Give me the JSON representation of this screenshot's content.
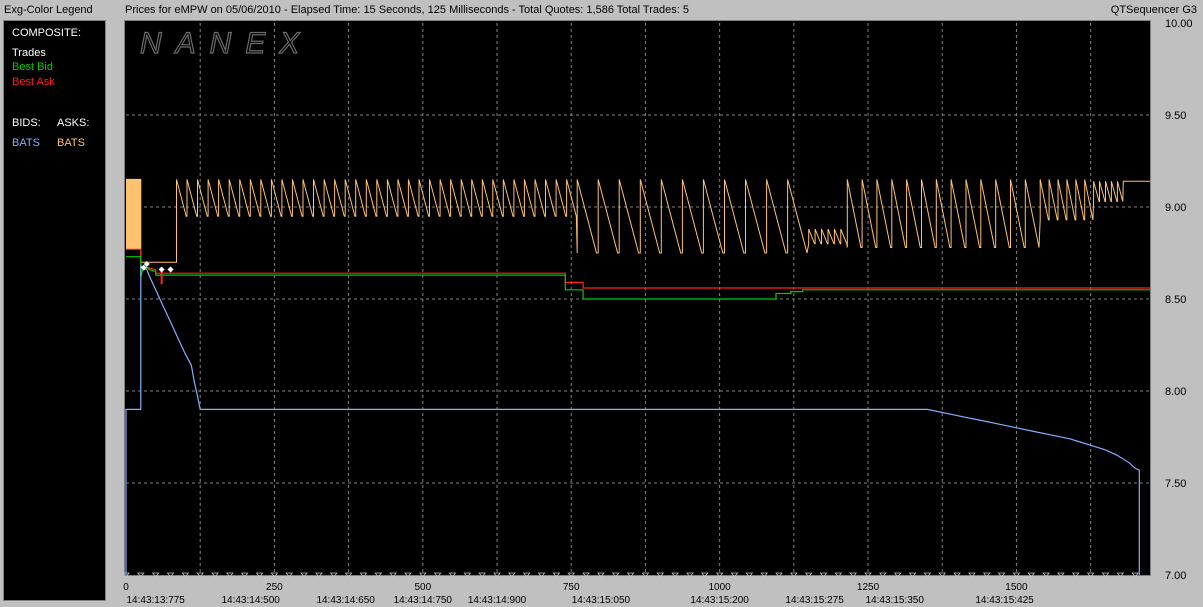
{
  "header": {
    "legend_title": "Exg-Color Legend",
    "chart_title": "Prices for  eMPW  on  05/06/2010  -  Elapsed Time: 15 Seconds, 125 Milliseconds  -  Total Quotes: 1,586  Total Trades: 5",
    "app_name": "QTSequencer G3"
  },
  "legend": {
    "composite_label": "COMPOSITE:",
    "trades_label": "Trades",
    "best_bid_label": "Best Bid",
    "best_ask_label": "Best Ask",
    "bids_label": "BIDS:",
    "asks_label": "ASKS:",
    "bid_exchange": "BATS",
    "ask_exchange": "BATS"
  },
  "watermark": "NANEX",
  "colors": {
    "background": "#000000",
    "trades": "#ffffff",
    "best_bid": "#00cc00",
    "best_ask": "#ff2020",
    "bats_bid": "#80b0ff",
    "bats_ask": "#ffc070",
    "grid": "#808080"
  },
  "chart_data": {
    "type": "line",
    "title": "Prices for  eMPW  on  05/06/2010  -  Elapsed Time: 15 Seconds, 125 Milliseconds  -  Total Quotes: 1,586  Total Trades: 5",
    "ylim": [
      7.0,
      10.0
    ],
    "xlim": [
      0,
      1725
    ],
    "grid": true,
    "y_ticks": [
      "7.00",
      "7.50",
      "8.00",
      "8.50",
      "9.00",
      "9.50",
      "10.00"
    ],
    "x_ticks": [
      "0",
      "250",
      "500",
      "750",
      "1000",
      "1250",
      "1500"
    ],
    "time_labels": [
      {
        "x": 50,
        "label": "14:43:13:775"
      },
      {
        "x": 210,
        "label": "14:43:14:500"
      },
      {
        "x": 370,
        "label": "14:43:14:650"
      },
      {
        "x": 500,
        "label": "14:43:14:750"
      },
      {
        "x": 625,
        "label": "14:43:14:900"
      },
      {
        "x": 800,
        "label": "14:43:15:050"
      },
      {
        "x": 1000,
        "label": "14:43:15:200"
      },
      {
        "x": 1160,
        "label": "14:43:15:275"
      },
      {
        "x": 1295,
        "label": "14:43:15:350"
      },
      {
        "x": 1480,
        "label": "14:43:15:425"
      }
    ],
    "series": [
      {
        "name": "Best Ask",
        "color": "#ff2020",
        "points": [
          [
            0,
            8.77
          ],
          [
            25,
            8.77
          ],
          [
            25,
            8.68
          ],
          [
            50,
            8.66
          ],
          [
            50,
            8.64
          ],
          [
            740,
            8.64
          ],
          [
            740,
            8.59
          ],
          [
            770,
            8.59
          ],
          [
            770,
            8.56
          ],
          [
            1725,
            8.56
          ]
        ]
      },
      {
        "name": "Best Bid",
        "color": "#00cc00",
        "points": [
          [
            0,
            8.73
          ],
          [
            25,
            8.73
          ],
          [
            25,
            8.62
          ],
          [
            30,
            8.68
          ],
          [
            40,
            8.66
          ],
          [
            50,
            8.65
          ],
          [
            50,
            8.63
          ],
          [
            740,
            8.63
          ],
          [
            740,
            8.55
          ],
          [
            770,
            8.55
          ],
          [
            770,
            8.5
          ],
          [
            1095,
            8.5
          ],
          [
            1095,
            8.53
          ],
          [
            1120,
            8.53
          ],
          [
            1120,
            8.54
          ],
          [
            1140,
            8.54
          ],
          [
            1140,
            8.55
          ],
          [
            1725,
            8.55
          ]
        ]
      },
      {
        "name": "BATS Bid",
        "color": "#80b0ff",
        "points": [
          [
            0,
            7.0
          ],
          [
            0,
            7.9
          ],
          [
            25,
            7.9
          ],
          [
            25,
            8.68
          ],
          [
            35,
            8.66
          ],
          [
            40,
            8.62
          ],
          [
            50,
            8.55
          ],
          [
            60,
            8.48
          ],
          [
            70,
            8.41
          ],
          [
            80,
            8.34
          ],
          [
            90,
            8.27
          ],
          [
            100,
            8.2
          ],
          [
            110,
            8.14
          ],
          [
            115,
            8.05
          ],
          [
            120,
            7.98
          ],
          [
            125,
            7.9
          ],
          [
            200,
            7.9
          ],
          [
            1350,
            7.9
          ],
          [
            1380,
            7.88
          ],
          [
            1410,
            7.86
          ],
          [
            1440,
            7.84
          ],
          [
            1470,
            7.82
          ],
          [
            1500,
            7.8
          ],
          [
            1530,
            7.78
          ],
          [
            1560,
            7.76
          ],
          [
            1590,
            7.74
          ],
          [
            1610,
            7.72
          ],
          [
            1630,
            7.7
          ],
          [
            1650,
            7.68
          ],
          [
            1670,
            7.65
          ],
          [
            1690,
            7.61
          ],
          [
            1700,
            7.58
          ],
          [
            1707,
            7.57
          ],
          [
            1707,
            7.0
          ]
        ]
      }
    ],
    "ask_sawtooth": {
      "name": "BATS Ask",
      "color": "#ffc070",
      "initial": [
        [
          0,
          9.15
        ],
        [
          25,
          9.15
        ],
        [
          25,
          8.7
        ],
        [
          85,
          8.7
        ],
        [
          85,
          8.95
        ]
      ],
      "segments": [
        {
          "x0": 85,
          "x1": 760,
          "low": 8.95,
          "high": 9.15,
          "teeth": 38
        },
        {
          "x0": 760,
          "x1": 1150,
          "low": 8.75,
          "high": 9.15,
          "teeth": 11
        },
        {
          "x0": 1150,
          "x1": 1215,
          "low": 8.8,
          "high": 8.88,
          "teeth": 6
        },
        {
          "x0": 1215,
          "x1": 1540,
          "low": 8.78,
          "high": 9.15,
          "teeth": 13
        },
        {
          "x0": 1540,
          "x1": 1630,
          "low": 8.93,
          "high": 9.15,
          "teeth": 6
        },
        {
          "x0": 1630,
          "x1": 1680,
          "low": 9.03,
          "high": 9.14,
          "teeth": 5
        }
      ],
      "final": [
        [
          1680,
          9.14
        ],
        [
          1725,
          9.14
        ]
      ],
      "box": {
        "x0": 0,
        "x1": 25,
        "low": 8.77,
        "high": 9.15
      }
    },
    "trades": [
      [
        30,
        8.67
      ],
      [
        35,
        8.69
      ],
      [
        60,
        8.66
      ],
      [
        75,
        8.66
      ]
    ]
  }
}
